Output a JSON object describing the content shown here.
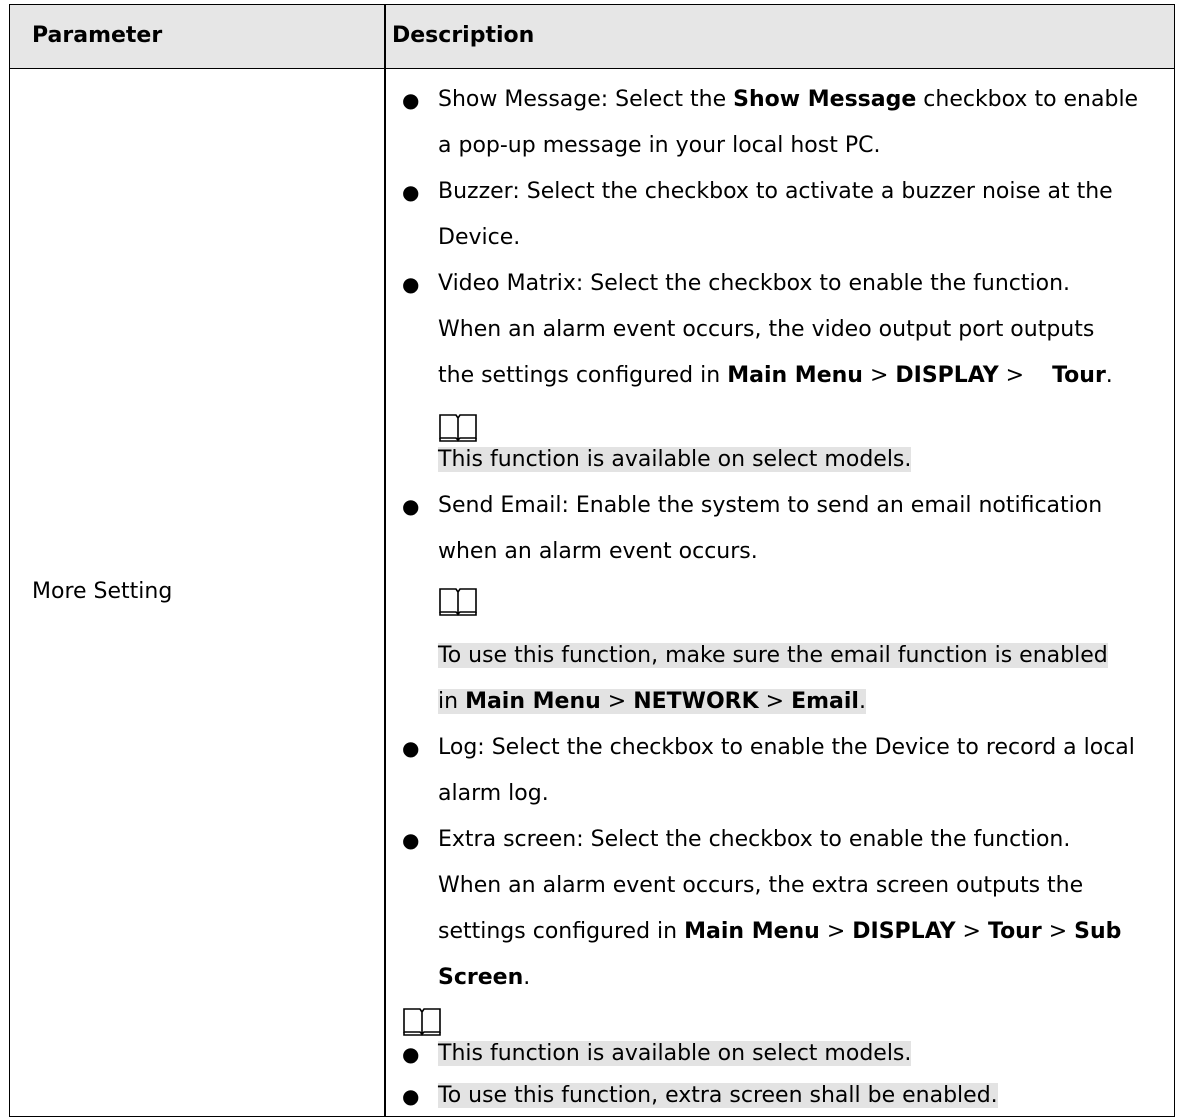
{
  "header": {
    "param": "Parameter",
    "desc": "Description"
  },
  "row": {
    "param": "More Setting"
  },
  "bullet_glyph": "●",
  "icons": {
    "note": "book-note-icon"
  },
  "desc": {
    "show_msg_a": "Show Message: Select the ",
    "show_msg_b": "Show Message",
    "show_msg_c": " checkbox to enable",
    "show_msg_d": "a pop-up message in your local host PC.",
    "buzzer_a": "Buzzer: Select the checkbox to activate a buzzer noise at the",
    "buzzer_b": "Device.",
    "vm_a": "Video Matrix: Select the checkbox to enable the function.",
    "vm_b": "When an alarm event occurs, the video output port outputs",
    "vm_c": "the settings configured in ",
    "vm_menu": "Main Menu",
    "vm_sep1": " > ",
    "vm_display": "DISPLAY",
    "vm_sep2": " >    ",
    "vm_tour": "Tour",
    "vm_end": ".",
    "note1": "This function is available on select models.",
    "email_a": "Send Email: Enable the system to send an email notification",
    "email_b": "when an alarm event occurs.",
    "note2_a": "To use this function, make sure the email function is enabled",
    "note2_b1": "in ",
    "note2_menu": "Main Menu",
    "note2_sep1": " > ",
    "note2_net": "NETWORK",
    "note2_sep2": " > ",
    "note2_email": "Email",
    "note2_end": ".",
    "log_a": "Log: Select the checkbox to enable the Device to record a local",
    "log_b": "alarm log.",
    "extra_a": "Extra screen: Select the checkbox to enable the function.",
    "extra_b": "When an alarm event occurs, the extra screen outputs the",
    "extra_c": "settings configured in ",
    "extra_menu": "Main Menu",
    "extra_sep1": " > ",
    "extra_display": "DISPLAY",
    "extra_sep2": " > ",
    "extra_tour": "Tour",
    "extra_sep3": " > ",
    "extra_sub": "Sub",
    "extra_screen": "Screen",
    "extra_end": ".",
    "note3_a": "This function is available on select models.",
    "note3_b": "To use this function, extra screen shall be enabled."
  }
}
